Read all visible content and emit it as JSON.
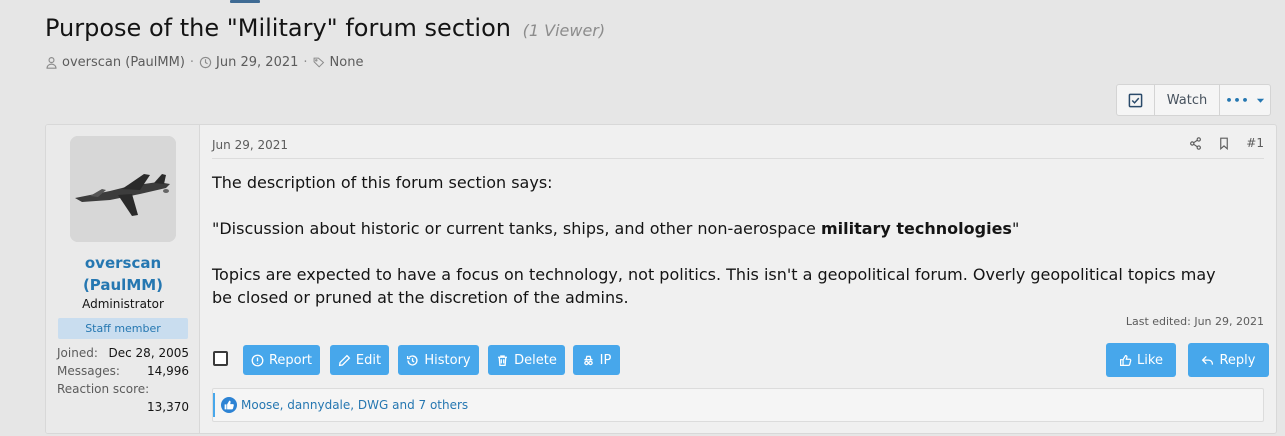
{
  "thread": {
    "title": "Purpose of the \"Military\" forum section",
    "viewers": "(1 Viewer)",
    "author": "overscan (PaulMM)",
    "date": "Jun 29, 2021",
    "tags": "None",
    "separator": "·"
  },
  "toolbar": {
    "watch_label": "Watch",
    "more_label": "•••"
  },
  "post": {
    "user": {
      "name_line1": "overscan",
      "name_line2": "(PaulMM)",
      "title": "Administrator",
      "badge": "Staff member",
      "stats": [
        {
          "label": "Joined:",
          "value": "Dec 28, 2005"
        },
        {
          "label": "Messages:",
          "value": "14,996"
        },
        {
          "label": "Reaction score:",
          "value": "13,370"
        }
      ]
    },
    "date": "Jun 29, 2021",
    "number": "#1",
    "body": {
      "p1": "The description of this forum section says:",
      "p2_pre": "\"Discussion about historic or current tanks, ships, and other non-aerospace ",
      "p2_bold": "military technologies",
      "p2_post": "\"",
      "p3": "Topics are expected to have a focus on technology, not politics. This isn't a geopolitical forum. Overly geopolitical topics may be closed or pruned at the discretion of the admins."
    },
    "last_edited": "Last edited: Jun 29, 2021",
    "actions": {
      "report": "Report",
      "edit": "Edit",
      "history": "History",
      "delete": "Delete",
      "ip": "IP",
      "like": "Like",
      "reply": "Reply"
    },
    "reactions": "Moose, dannydale, DWG and 7 others"
  },
  "colors": {
    "link": "#2577b1",
    "button": "#47a7eb",
    "background": "#e6e6e6"
  }
}
